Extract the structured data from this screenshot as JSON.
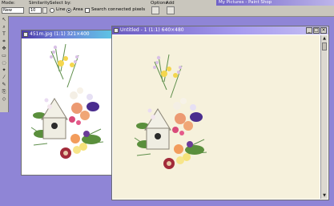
{
  "toolbar": {
    "mode_label": "Mode:",
    "mode_value": "New",
    "similarity_label": "Similarity:",
    "similarity_value": "10",
    "select_by_label": "Select by:",
    "select_by_options": [
      "Line",
      "Area"
    ],
    "search_connected_label": "Search connected pixels",
    "options_label": "Options",
    "add_label": "Add"
  },
  "app_title": "My Pictures - Paint Shop",
  "tools": [
    "arrow-tool-icon",
    "zoom-tool-icon",
    "text-tool-icon",
    "crop-tool-icon",
    "move-tool-icon",
    "select-tool-icon",
    "lasso-tool-icon",
    "magic-wand-tool-icon",
    "dropper-tool-icon",
    "paint-brush-tool-icon",
    "clone-tool-icon",
    "eraser-tool-icon"
  ],
  "windows": [
    {
      "title": "451m.jpg (1:1) 321×400"
    },
    {
      "title": "Untitled - 1 (1:1) 640×480"
    }
  ],
  "window_buttons": {
    "minimize": "_",
    "maximize": "□",
    "close": "×"
  },
  "colors": {
    "desktop": "#8f85d6",
    "canvas_bg": "#f6f1dc"
  }
}
